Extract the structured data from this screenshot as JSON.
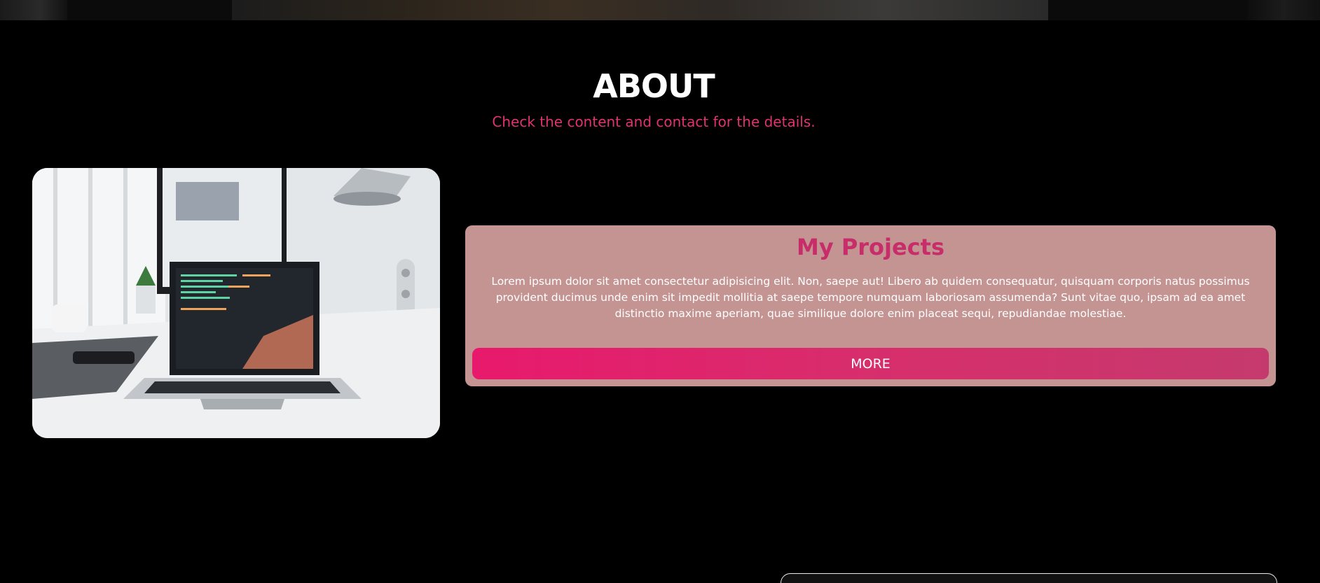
{
  "about": {
    "title": "ABOUT",
    "subtitle": "Check the content and contact for the details."
  },
  "photo": {
    "icon": "laptop-desk-photo"
  },
  "projects": {
    "title": "My Projects",
    "text": "Lorem ipsum dolor sit amet consectetur adipisicing elit. Non, saepe aut! Libero ab quidem consequatur, quisquam corporis natus possimus provident ducimus unde enim sit impedit mollitia at saepe tempore numquam laboriosam assumenda? Sunt vitae quo, ipsam ad ea amet distinctio maxime aperiam, quae similique dolore enim placeat sequi, repudiandae molestiae.",
    "button_label": "MORE"
  },
  "colors": {
    "background": "#000000",
    "accent": "#e0336f",
    "card": "#c49493",
    "button": "#e8196c"
  }
}
